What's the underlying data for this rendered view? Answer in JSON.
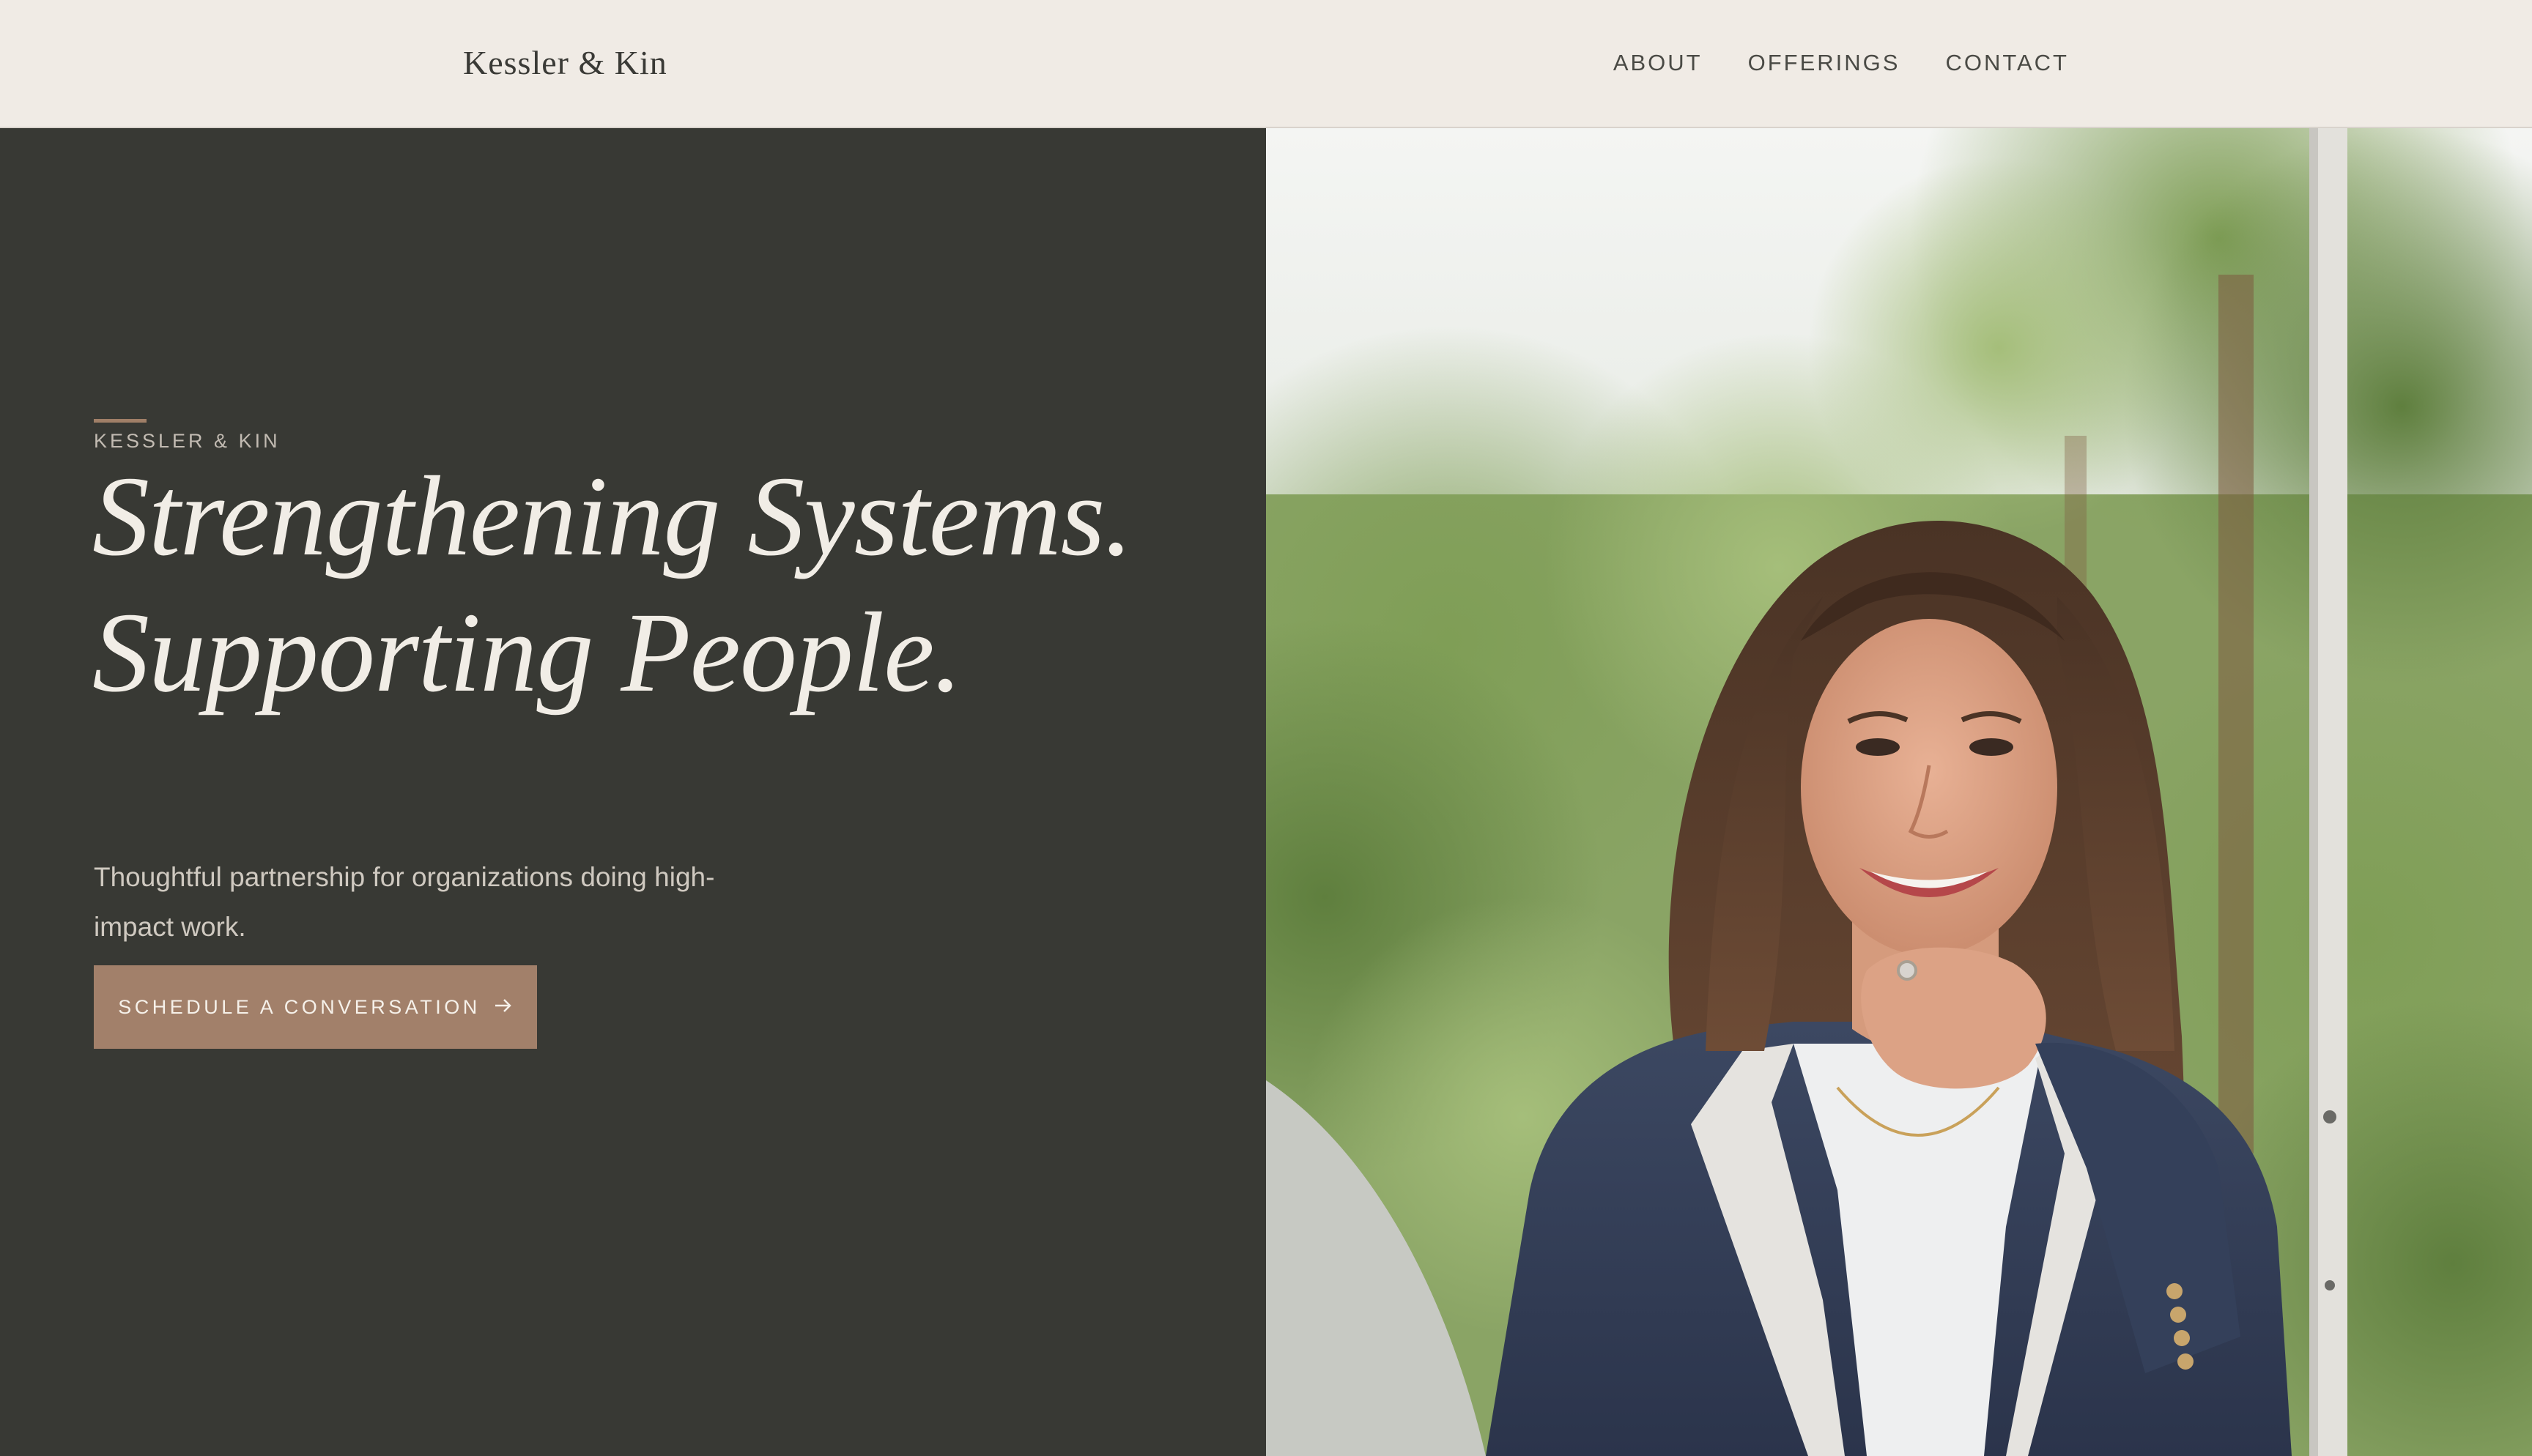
{
  "header": {
    "brand": "Kessler & Kin",
    "nav": [
      {
        "label": "ABOUT"
      },
      {
        "label": "OFFERINGS"
      },
      {
        "label": "CONTACT"
      }
    ]
  },
  "hero": {
    "eyebrow": "KESSLER & KIN",
    "headline_line1": "Strengthening Systems.",
    "headline_line2": "Supporting People.",
    "subhead": "Thoughtful partnership for organizations doing high-impact work.",
    "cta_label": "SCHEDULE A CONVERSATION",
    "cta_icon": "arrow-right-icon"
  },
  "colors": {
    "header_bg": "#f0ebe5",
    "hero_bg": "#383934",
    "accent": "#a2806a",
    "headline": "#f1ede6"
  }
}
